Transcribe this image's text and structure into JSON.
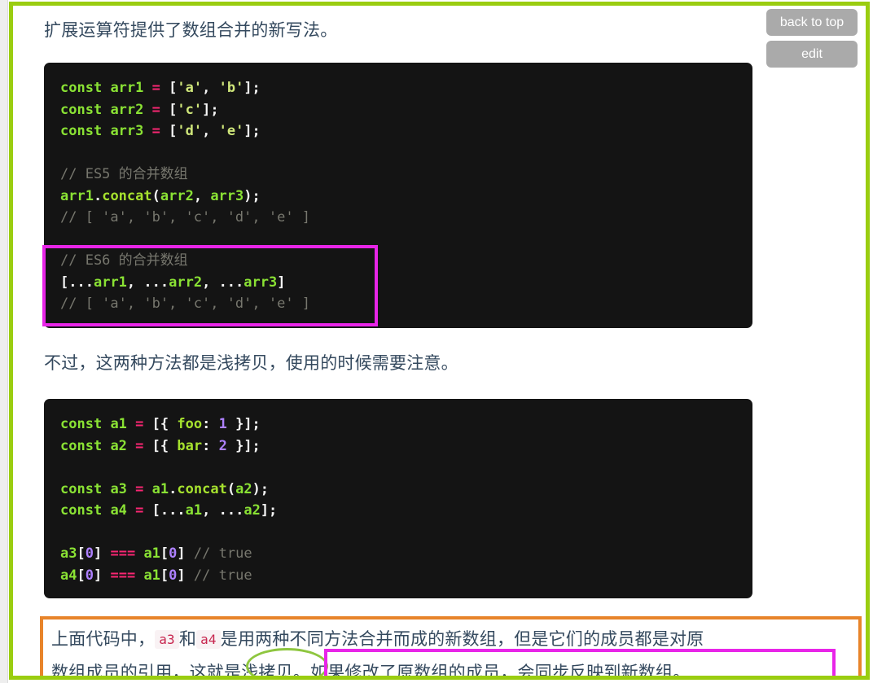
{
  "page": {
    "language": "zh-CN",
    "frame_color": "#9acd10",
    "annotation_colors": {
      "magenta": "#e825e8",
      "orange": "#e8842a",
      "green": "#8ec63f"
    }
  },
  "buttons": [
    {
      "id": "back-to-top",
      "label": "back to top"
    },
    {
      "id": "edit",
      "label": "edit"
    }
  ],
  "paragraphs": {
    "intro": "扩展运算符提供了数组合并的新写法。",
    "middle": "不过，这两种方法都是浅拷贝，使用的时候需要注意。"
  },
  "code_block_1": {
    "language": "javascript",
    "lines": [
      [
        {
          "t": "const",
          "c": "k"
        },
        {
          "t": " ",
          "c": "pun"
        },
        {
          "t": "arr1",
          "c": "var"
        },
        {
          "t": " ",
          "c": "pun"
        },
        {
          "t": "=",
          "c": "op"
        },
        {
          "t": " ",
          "c": "pun"
        },
        {
          "t": "[",
          "c": "pun"
        },
        {
          "t": "'a'",
          "c": "str"
        },
        {
          "t": ", ",
          "c": "pun"
        },
        {
          "t": "'b'",
          "c": "str"
        },
        {
          "t": "];",
          "c": "pun"
        }
      ],
      [
        {
          "t": "const",
          "c": "k"
        },
        {
          "t": " ",
          "c": "pun"
        },
        {
          "t": "arr2",
          "c": "var"
        },
        {
          "t": " ",
          "c": "pun"
        },
        {
          "t": "=",
          "c": "op"
        },
        {
          "t": " ",
          "c": "pun"
        },
        {
          "t": "[",
          "c": "pun"
        },
        {
          "t": "'c'",
          "c": "str"
        },
        {
          "t": "];",
          "c": "pun"
        }
      ],
      [
        {
          "t": "const",
          "c": "k"
        },
        {
          "t": " ",
          "c": "pun"
        },
        {
          "t": "arr3",
          "c": "var"
        },
        {
          "t": " ",
          "c": "pun"
        },
        {
          "t": "=",
          "c": "op"
        },
        {
          "t": " ",
          "c": "pun"
        },
        {
          "t": "[",
          "c": "pun"
        },
        {
          "t": "'d'",
          "c": "str"
        },
        {
          "t": ", ",
          "c": "pun"
        },
        {
          "t": "'e'",
          "c": "str"
        },
        {
          "t": "];",
          "c": "pun"
        }
      ],
      [],
      [
        {
          "t": "// ES5 的合并数组",
          "c": "cmt"
        }
      ],
      [
        {
          "t": "arr1",
          "c": "var"
        },
        {
          "t": ".",
          "c": "pun"
        },
        {
          "t": "concat",
          "c": "prop"
        },
        {
          "t": "(",
          "c": "pun"
        },
        {
          "t": "arr2",
          "c": "var"
        },
        {
          "t": ", ",
          "c": "pun"
        },
        {
          "t": "arr3",
          "c": "var"
        },
        {
          "t": ");",
          "c": "pun"
        }
      ],
      [
        {
          "t": "// [ 'a', 'b', 'c', 'd', 'e' ]",
          "c": "cmt"
        }
      ],
      [],
      [
        {
          "t": "// ES6 的合并数组",
          "c": "cmt"
        }
      ],
      [
        {
          "t": "[",
          "c": "pun"
        },
        {
          "t": "...",
          "c": "pun"
        },
        {
          "t": "arr1",
          "c": "var"
        },
        {
          "t": ", ",
          "c": "pun"
        },
        {
          "t": "...",
          "c": "pun"
        },
        {
          "t": "arr2",
          "c": "var"
        },
        {
          "t": ", ",
          "c": "pun"
        },
        {
          "t": "...",
          "c": "pun"
        },
        {
          "t": "arr3",
          "c": "var"
        },
        {
          "t": "]",
          "c": "pun"
        }
      ],
      [
        {
          "t": "// [ 'a', 'b', 'c', 'd', 'e' ]",
          "c": "cmt"
        }
      ]
    ],
    "highlight": {
      "label": "es6-merge-highlight",
      "color": "#e825e8",
      "covers_lines": [
        "// ES6 的合并数组",
        "[...arr1, ...arr2, ...arr3]",
        "// [ 'a', 'b', 'c', 'd', 'e' ]"
      ]
    }
  },
  "code_block_2": {
    "language": "javascript",
    "lines": [
      [
        {
          "t": "const",
          "c": "k"
        },
        {
          "t": " ",
          "c": "pun"
        },
        {
          "t": "a1",
          "c": "var"
        },
        {
          "t": " ",
          "c": "pun"
        },
        {
          "t": "=",
          "c": "op"
        },
        {
          "t": " ",
          "c": "pun"
        },
        {
          "t": "[{ ",
          "c": "pun"
        },
        {
          "t": "foo",
          "c": "prop"
        },
        {
          "t": ": ",
          "c": "pun"
        },
        {
          "t": "1",
          "c": "num"
        },
        {
          "t": " }];",
          "c": "pun"
        }
      ],
      [
        {
          "t": "const",
          "c": "k"
        },
        {
          "t": " ",
          "c": "pun"
        },
        {
          "t": "a2",
          "c": "var"
        },
        {
          "t": " ",
          "c": "pun"
        },
        {
          "t": "=",
          "c": "op"
        },
        {
          "t": " ",
          "c": "pun"
        },
        {
          "t": "[{ ",
          "c": "pun"
        },
        {
          "t": "bar",
          "c": "prop"
        },
        {
          "t": ": ",
          "c": "pun"
        },
        {
          "t": "2",
          "c": "num"
        },
        {
          "t": " }];",
          "c": "pun"
        }
      ],
      [],
      [
        {
          "t": "const",
          "c": "k"
        },
        {
          "t": " ",
          "c": "pun"
        },
        {
          "t": "a3",
          "c": "var"
        },
        {
          "t": " ",
          "c": "pun"
        },
        {
          "t": "=",
          "c": "op"
        },
        {
          "t": " ",
          "c": "pun"
        },
        {
          "t": "a1",
          "c": "var"
        },
        {
          "t": ".",
          "c": "pun"
        },
        {
          "t": "concat",
          "c": "prop"
        },
        {
          "t": "(",
          "c": "pun"
        },
        {
          "t": "a2",
          "c": "var"
        },
        {
          "t": ");",
          "c": "pun"
        }
      ],
      [
        {
          "t": "const",
          "c": "k"
        },
        {
          "t": " ",
          "c": "pun"
        },
        {
          "t": "a4",
          "c": "var"
        },
        {
          "t": " ",
          "c": "pun"
        },
        {
          "t": "=",
          "c": "op"
        },
        {
          "t": " ",
          "c": "pun"
        },
        {
          "t": "[",
          "c": "pun"
        },
        {
          "t": "...",
          "c": "pun"
        },
        {
          "t": "a1",
          "c": "var"
        },
        {
          "t": ", ",
          "c": "pun"
        },
        {
          "t": "...",
          "c": "pun"
        },
        {
          "t": "a2",
          "c": "var"
        },
        {
          "t": "];",
          "c": "pun"
        }
      ],
      [],
      [
        {
          "t": "a3",
          "c": "var"
        },
        {
          "t": "[",
          "c": "pun"
        },
        {
          "t": "0",
          "c": "num"
        },
        {
          "t": "] ",
          "c": "pun"
        },
        {
          "t": "===",
          "c": "op"
        },
        {
          "t": " ",
          "c": "pun"
        },
        {
          "t": "a1",
          "c": "var"
        },
        {
          "t": "[",
          "c": "pun"
        },
        {
          "t": "0",
          "c": "num"
        },
        {
          "t": "] ",
          "c": "pun"
        },
        {
          "t": "// true",
          "c": "cmt"
        }
      ],
      [
        {
          "t": "a4",
          "c": "var"
        },
        {
          "t": "[",
          "c": "pun"
        },
        {
          "t": "0",
          "c": "num"
        },
        {
          "t": "] ",
          "c": "pun"
        },
        {
          "t": "===",
          "c": "op"
        },
        {
          "t": " ",
          "c": "pun"
        },
        {
          "t": "a1",
          "c": "var"
        },
        {
          "t": "[",
          "c": "pun"
        },
        {
          "t": "0",
          "c": "num"
        },
        {
          "t": "] ",
          "c": "pun"
        },
        {
          "t": "// true",
          "c": "cmt"
        }
      ]
    ]
  },
  "note": {
    "line1": {
      "seg1": "上面代码中，",
      "code1": "a3",
      "seg2": "和",
      "code2": "a4",
      "seg3": "是用两种不同方法合并而成的新数组，但是它们的成员都是对原"
    },
    "line2": {
      "seg1": "数组成员的引用，这就是",
      "circled": "浅拷贝。",
      "boxed": "如果修改了原数组的成员，会同步反映到新数组",
      "seg_end": "。"
    }
  }
}
